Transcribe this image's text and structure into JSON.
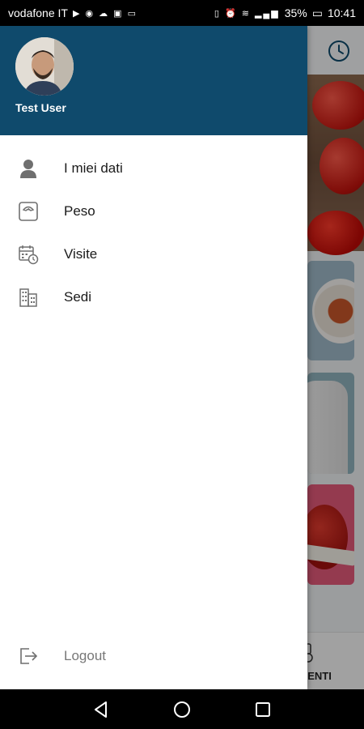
{
  "status_bar": {
    "carrier": "vodafone IT",
    "battery": "35%",
    "time": "10:41"
  },
  "drawer": {
    "user_name": "Test User",
    "menu_items": [
      {
        "label": "I miei dati",
        "icon": "person-icon"
      },
      {
        "label": "Peso",
        "icon": "scale-icon"
      },
      {
        "label": "Visite",
        "icon": "calendar-clock-icon"
      },
      {
        "label": "Sedi",
        "icon": "building-icon"
      }
    ],
    "logout_label": "Logout"
  },
  "background": {
    "bottom_tab_label": "AMENTI"
  },
  "colors": {
    "drawer_header": "#0f4a6c",
    "icon_gray": "#6f6f6f"
  }
}
